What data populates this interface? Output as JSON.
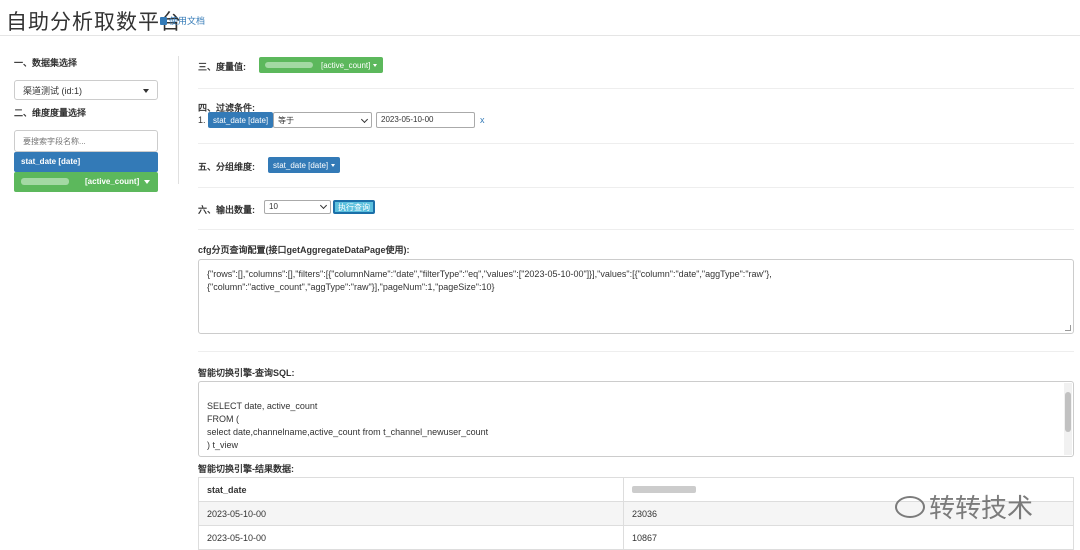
{
  "header": {
    "title": "自助分析取数平台",
    "doc_link": "使用文档"
  },
  "sidebar": {
    "dataset_label": "一、数据集选择",
    "dataset_value": "渠道测试 (id:1)",
    "dimension_label": "二、维度度量选择",
    "search_placeholder": "要搜索字段名称...",
    "fields": [
      {
        "label": "stat_date [date]",
        "kind": "dimension"
      },
      {
        "label": "[active_count]",
        "kind": "measure"
      }
    ]
  },
  "main": {
    "measure_label": "三、度量值:",
    "measure_button": "[active_count]",
    "filter_label": "四、过滤条件:",
    "filter_index": "1.",
    "filter_field": "stat_date [date]",
    "filter_operator": "等于",
    "filter_value": "2023-05-10-00",
    "filter_remove": "x",
    "group_label": "五、分组维度:",
    "group_button": "stat_date [date]",
    "output_label": "六、输出数量:",
    "output_count": "10",
    "run_button": "执行查询",
    "cfg_label": "cfg分页查询配置(接口getAggregateDataPage使用):",
    "cfg_lines": [
      "{\"rows\":[],\"columns\":[],\"filters\":[{\"columnName\":\"date\",\"filterType\":\"eq\",\"values\":[\"2023-05-10-00\"]}],\"values\":[{\"column\":\"date\",\"aggType\":\"raw\"},",
      "{\"column\":\"active_count\",\"aggType\":\"raw\"}],\"pageNum\":1,\"pageSize\":10}"
    ],
    "sql_label": "智能切换引擎-查询SQL:",
    "sql_lines": [
      "",
      "SELECT date, active_count",
      " FROM (",
      "select date,channelname,active_count from t_channel_newuser_count",
      ") t_view"
    ],
    "result_label": "智能切换引擎-结果数据:",
    "result_columns": [
      "stat_date",
      ""
    ],
    "result_rows": [
      [
        "2023-05-10-00",
        "23036"
      ],
      [
        "2023-05-10-00",
        "10867"
      ]
    ]
  },
  "watermark": {
    "text": "转转技术"
  }
}
